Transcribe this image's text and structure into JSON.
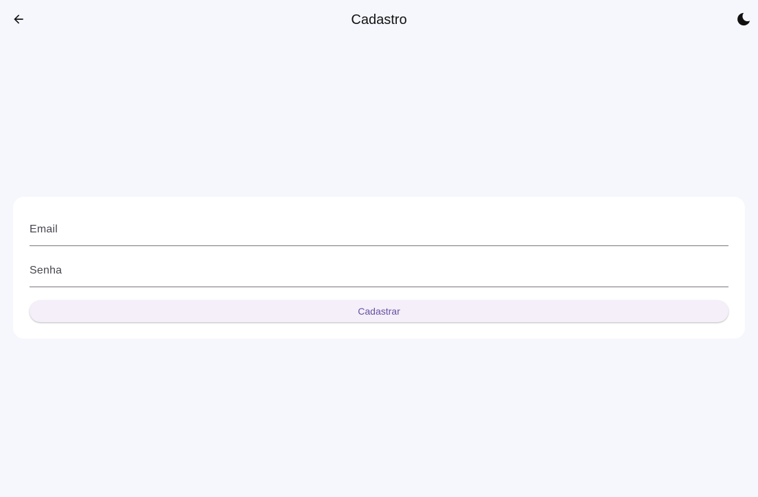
{
  "app_bar": {
    "title": "Cadastro",
    "back_icon": "arrow-back-icon",
    "theme_icon": "moon-icon"
  },
  "form": {
    "email_label": "Email",
    "password_label": "Senha",
    "submit_label": "Cadastrar"
  },
  "colors": {
    "background": "#f6f7fc",
    "card": "#ffffff",
    "accent": "#6750a4",
    "button_bg": "#f4eff8"
  }
}
